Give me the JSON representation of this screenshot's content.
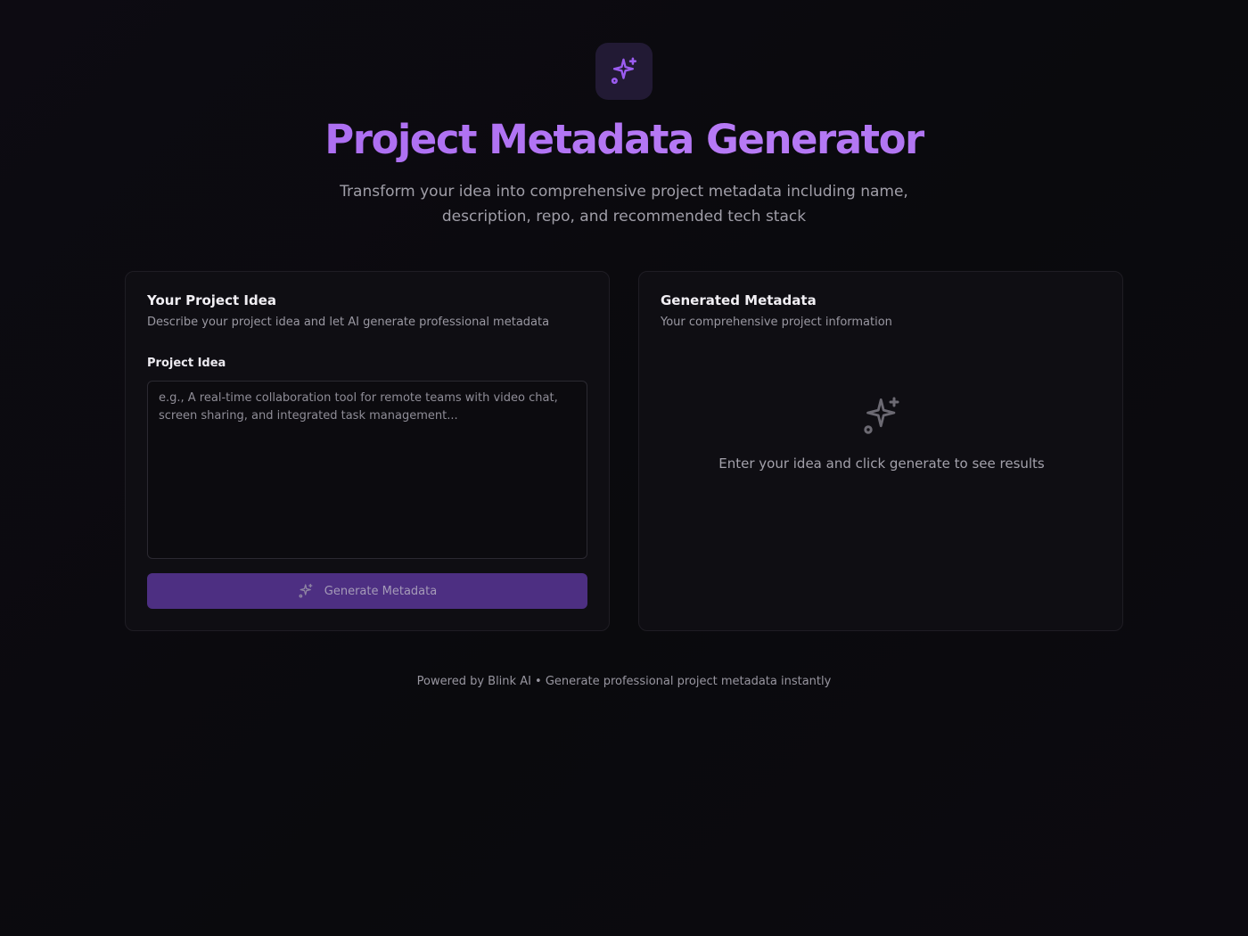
{
  "header": {
    "logo_icon": "sparkles-icon",
    "title": "Project Metadata Generator",
    "subtitle": "Transform your idea into comprehensive project metadata including name, description, repo, and recommended tech stack"
  },
  "input_card": {
    "title": "Your Project Idea",
    "description": "Describe your project idea and let AI generate professional metadata",
    "field_label": "Project Idea",
    "placeholder": "e.g., A real-time collaboration tool for remote teams with video chat, screen sharing, and integrated task management...",
    "value": "",
    "button_label": "Generate Metadata",
    "button_icon": "sparkles-icon"
  },
  "output_card": {
    "title": "Generated Metadata",
    "description": "Your comprehensive project information",
    "empty_icon": "sparkles-icon",
    "empty_text": "Enter your idea and click generate to see results"
  },
  "footer": {
    "text": "Powered by Blink AI • Generate professional project metadata instantly"
  },
  "colors": {
    "accent": "#b06bf3",
    "button": "#4d2f82",
    "background": "#0a0a0d"
  }
}
